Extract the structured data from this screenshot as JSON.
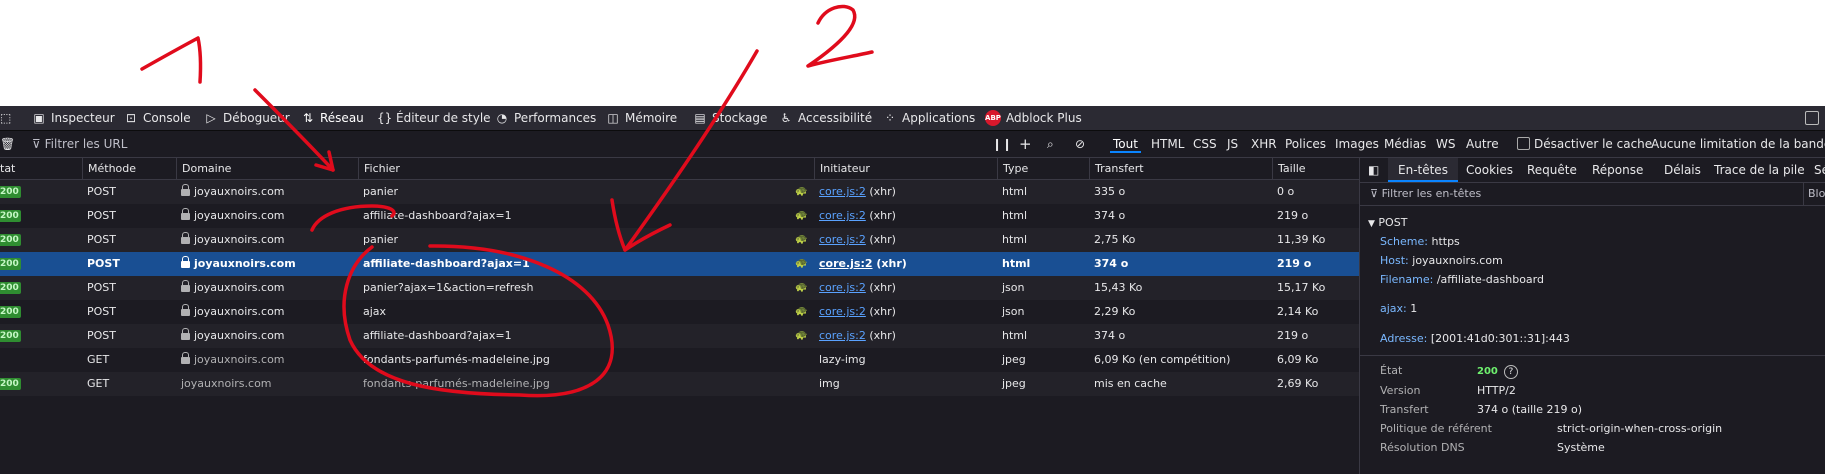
{
  "annotations": {
    "label1": "1",
    "label2": "2"
  },
  "toolbar": {
    "tabs": [
      {
        "label": "Inspecteur",
        "icon": "inspector-icon"
      },
      {
        "label": "Console",
        "icon": "console-icon"
      },
      {
        "label": "Débogueur",
        "icon": "debugger-icon"
      },
      {
        "label": "Réseau",
        "icon": "network-icon"
      },
      {
        "label": "Éditeur de style",
        "icon": "style-editor-icon"
      },
      {
        "label": "Performances",
        "icon": "performance-icon"
      },
      {
        "label": "Mémoire",
        "icon": "memory-icon"
      },
      {
        "label": "Stockage",
        "icon": "storage-icon"
      },
      {
        "label": "Accessibilité",
        "icon": "accessibility-icon"
      },
      {
        "label": "Applications",
        "icon": "applications-icon"
      },
      {
        "label": "Adblock Plus",
        "icon": "abp-icon",
        "badge": "ABP"
      }
    ]
  },
  "filterbar": {
    "placeholder": "Filtrer les URL",
    "types": [
      "Tout",
      "HTML",
      "CSS",
      "JS",
      "XHR",
      "Polices",
      "Images",
      "Médias",
      "WS",
      "Autre"
    ],
    "disable_cache": "Désactiver le cache",
    "throttling": "Aucune limitation de la bande pas"
  },
  "columns": {
    "status": "tat",
    "method": "Méthode",
    "domain": "Domaine",
    "file": "Fichier",
    "initiator": "Initiateur",
    "type": "Type",
    "transfer": "Transfert",
    "size": "Taille"
  },
  "rows": [
    {
      "status": "200",
      "method": "POST",
      "domain": "joyauxnoirs.com",
      "file": "panier",
      "initiator_link": "core.js:2",
      "initiator_suffix": "(xhr)",
      "type": "html",
      "transfer": "335 o",
      "size": "0 o"
    },
    {
      "status": "200",
      "method": "POST",
      "domain": "joyauxnoirs.com",
      "file": "affiliate-dashboard?ajax=1",
      "initiator_link": "core.js:2",
      "initiator_suffix": "(xhr)",
      "type": "html",
      "transfer": "374 o",
      "size": "219 o"
    },
    {
      "status": "200",
      "method": "POST",
      "domain": "joyauxnoirs.com",
      "file": "panier",
      "initiator_link": "core.js:2",
      "initiator_suffix": "(xhr)",
      "type": "html",
      "transfer": "2,75 Ko",
      "size": "11,39 Ko"
    },
    {
      "status": "200",
      "method": "POST",
      "domain": "joyauxnoirs.com",
      "file": "affiliate-dashboard?ajax=1",
      "initiator_link": "core.js:2",
      "initiator_suffix": "(xhr)",
      "type": "html",
      "transfer": "374 o",
      "size": "219 o"
    },
    {
      "status": "200",
      "method": "POST",
      "domain": "joyauxnoirs.com",
      "file": "panier?ajax=1&action=refresh",
      "initiator_link": "core.js:2",
      "initiator_suffix": "(xhr)",
      "type": "json",
      "transfer": "15,43 Ko",
      "size": "15,17 Ko"
    },
    {
      "status": "200",
      "method": "POST",
      "domain": "joyauxnoirs.com",
      "file": "ajax",
      "initiator_link": "core.js:2",
      "initiator_suffix": "(xhr)",
      "type": "json",
      "transfer": "2,29 Ko",
      "size": "2,14 Ko"
    },
    {
      "status": "200",
      "method": "POST",
      "domain": "joyauxnoirs.com",
      "file": "affiliate-dashboard?ajax=1",
      "initiator_link": "core.js:2",
      "initiator_suffix": "(xhr)",
      "type": "html",
      "transfer": "374 o",
      "size": "219 o"
    },
    {
      "status": "",
      "method": "GET",
      "domain": "joyauxnoirs.com",
      "file": "fondants-parfumés-madeleine.jpg",
      "initiator_link": "",
      "initiator_suffix": "lazy-img",
      "type": "jpeg",
      "transfer": "6,09 Ko (en compétition)",
      "size": "6,09 Ko"
    },
    {
      "status": "200",
      "method": "GET",
      "domain": "joyauxnoirs.com",
      "file": "fondants-parfumés-madeleine.jpg",
      "initiator_link": "",
      "initiator_suffix": "img",
      "type": "jpeg",
      "transfer": "mis en cache",
      "size": "2,69 Ko"
    }
  ],
  "panel": {
    "tabs": [
      "En-têtes",
      "Cookies",
      "Requête",
      "Réponse",
      "Délais",
      "Trace de la pile",
      "Sé"
    ],
    "filter_placeholder": "Filtrer les en-têtes",
    "filter_right": "Blo",
    "section": "POST",
    "scheme_k": "Scheme:",
    "scheme_v": "https",
    "host_k": "Host:",
    "host_v": "joyauxnoirs.com",
    "filename_k": "Filename:",
    "filename_v": "/affiliate-dashboard",
    "ajax_k": "ajax:",
    "ajax_v": "1",
    "address_k": "Adresse:",
    "address_v": "[2001:41d0:301::31]:443",
    "state_k": "État",
    "state_v": "200",
    "version_k": "Version",
    "version_v": "HTTP/2",
    "transfer_k": "Transfert",
    "transfer_v": "374 o (taille 219 o)",
    "referrer_k": "Politique de référent",
    "referrer_v": "strict-origin-when-cross-origin",
    "dns_k": "Résolution DNS",
    "dns_v": "Système"
  }
}
